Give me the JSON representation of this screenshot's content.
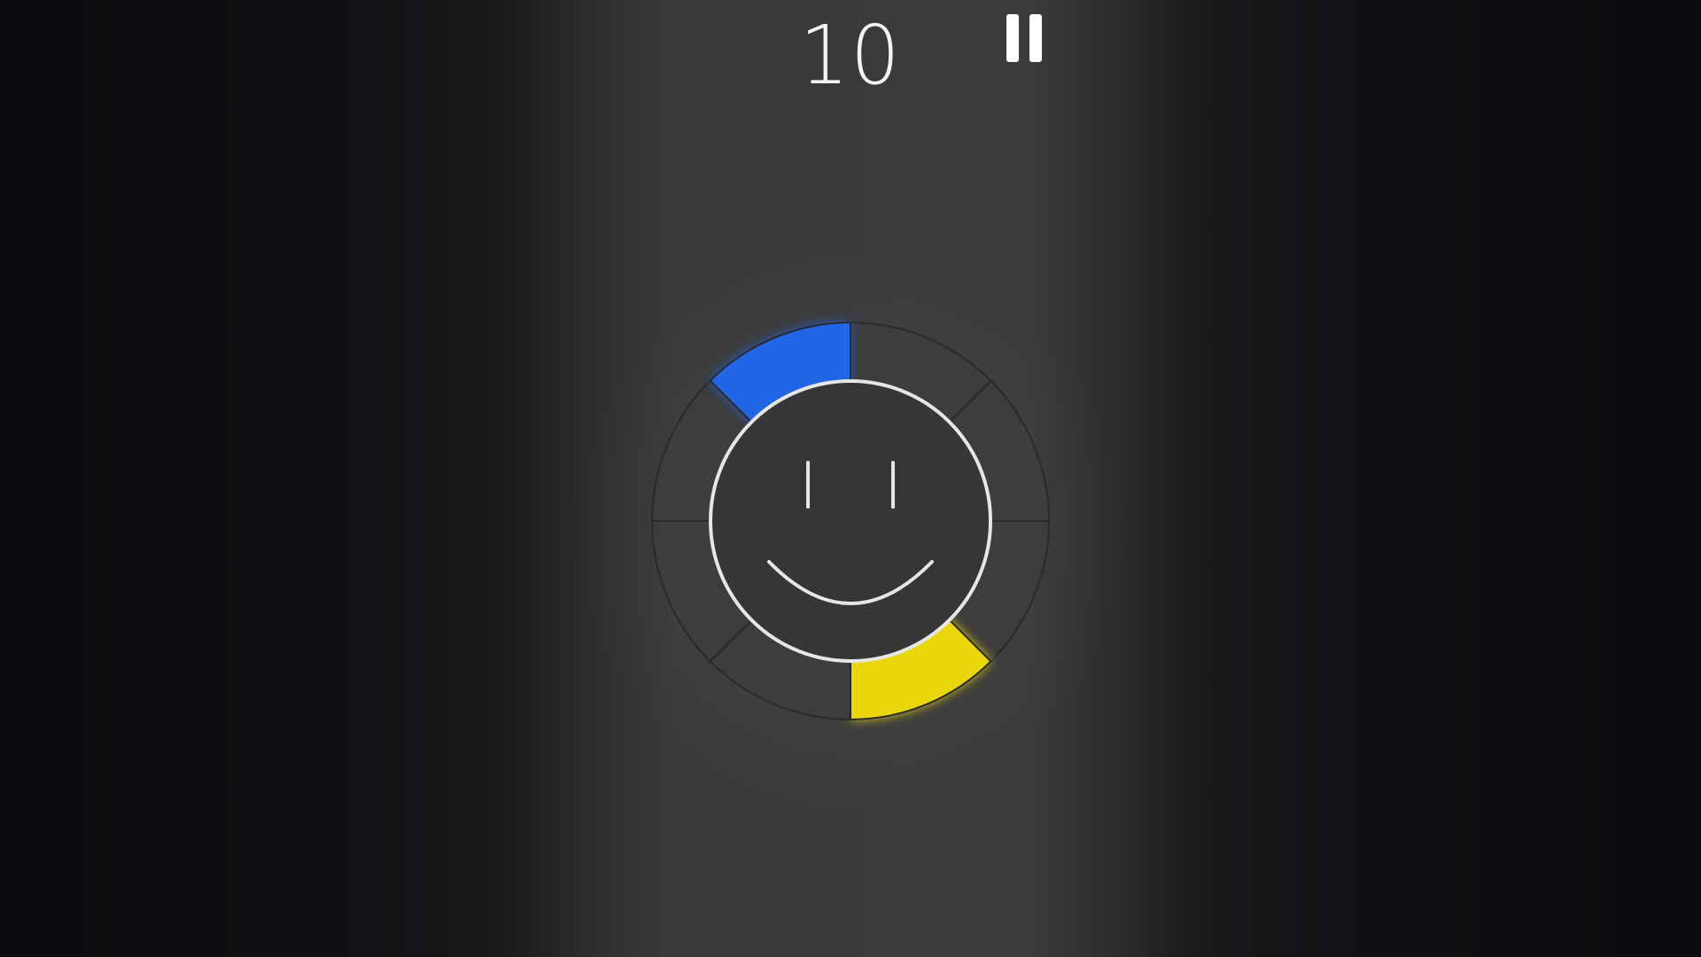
{
  "hud": {
    "score": "10",
    "pause_icon": "pause-icon"
  },
  "game": {
    "ring": {
      "segment_count": 8,
      "segments": [
        {
          "name": "ring-segment-1",
          "color": "#3d3d3d"
        },
        {
          "name": "ring-segment-2",
          "color": "#3d3d3d"
        },
        {
          "name": "ring-segment-3",
          "color": "#3d3d3d"
        },
        {
          "name": "ring-segment-4",
          "color": "#e9d60b"
        },
        {
          "name": "ring-segment-5",
          "color": "#3d3d3d"
        },
        {
          "name": "ring-segment-6",
          "color": "#3d3d3d"
        },
        {
          "name": "ring-segment-7",
          "color": "#3d3d3d"
        },
        {
          "name": "ring-segment-8",
          "color": "#2366e6"
        }
      ]
    },
    "face": {
      "icon": "smiley-face-icon",
      "stroke_color": "#e6e6e6"
    },
    "colors": {
      "background": "#0c0d10",
      "lane": "#3a3a3a",
      "blue": "#2366e6",
      "yellow": "#e9d60b"
    }
  }
}
